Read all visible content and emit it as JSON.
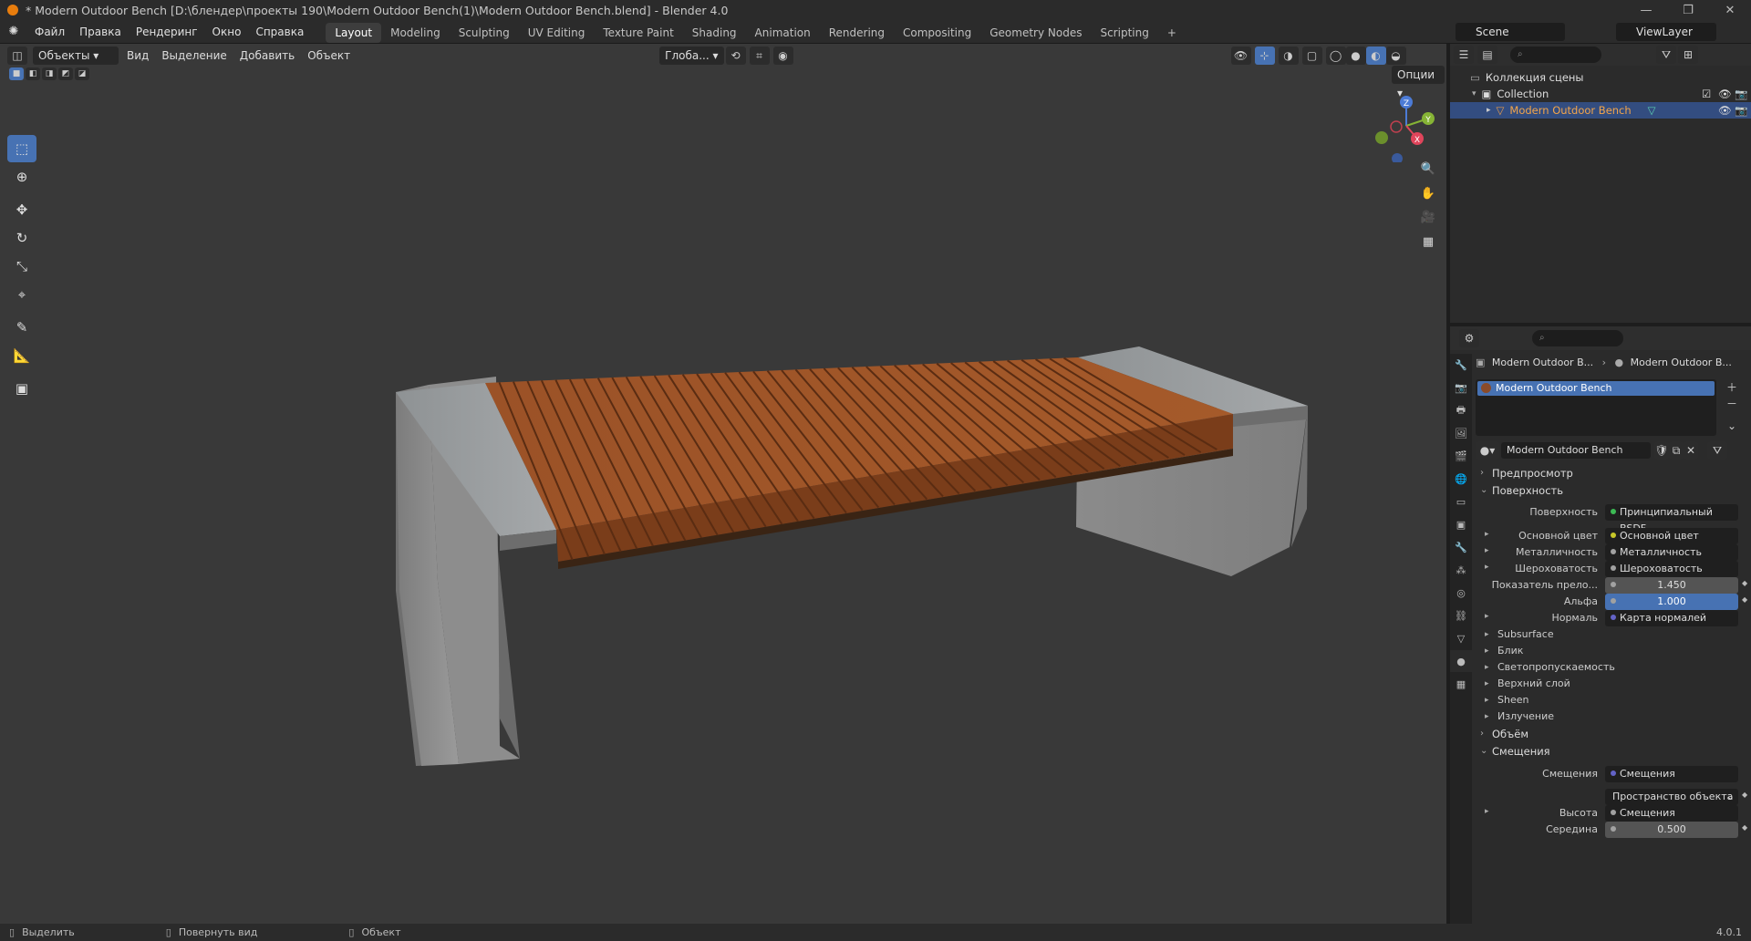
{
  "window": {
    "title": "* Modern Outdoor Bench [D:\\блендер\\проекты 190\\Modern Outdoor Bench(1)\\Modern Outdoor Bench.blend] - Blender 4.0",
    "minimize": "—",
    "maximize": "❐",
    "close": "✕"
  },
  "menu": [
    "Файл",
    "Правка",
    "Рендеринг",
    "Окно",
    "Справка"
  ],
  "workspaces": [
    "Layout",
    "Modeling",
    "Sculpting",
    "UV Editing",
    "Texture Paint",
    "Shading",
    "Animation",
    "Rendering",
    "Compositing",
    "Geometry Nodes",
    "Scripting"
  ],
  "workspace_add": "+",
  "scene": "Scene",
  "view_layer": "ViewLayer",
  "viewport_header": {
    "mode": "Объекты",
    "menus": [
      "Вид",
      "Выделение",
      "Добавить",
      "Объект"
    ],
    "orientation": "Глоба...",
    "options": "Опции"
  },
  "gizmo": {
    "x": "X",
    "y": "Y",
    "z": "Z"
  },
  "outliner": {
    "root": "Коллекция сцены",
    "collection": "Collection",
    "object": "Modern Outdoor Bench"
  },
  "properties": {
    "breadcrumb_object": "Modern Outdoor B...",
    "breadcrumb_material": "Modern Outdoor B...",
    "slot_name": "Modern Outdoor Bench",
    "material_name": "Modern Outdoor Bench",
    "sections": {
      "preview": "Предпросмотр",
      "surface": "Поверхность",
      "volume": "Объём",
      "displacement": "Смещения"
    },
    "surface_rows": [
      {
        "label": "Поверхность",
        "value": "Принципиальный BSDF",
        "dot": "#3cba54",
        "arrow": false,
        "type": "link"
      },
      {
        "label": "Основной цвет",
        "value": "Основной цвет",
        "dot": "#c7c729",
        "arrow": true,
        "type": "link"
      },
      {
        "label": "Металличность",
        "value": "Металличность",
        "dot": "#a1a1a1",
        "arrow": true,
        "type": "link"
      },
      {
        "label": "Шероховатость",
        "value": "Шероховатость",
        "dot": "#a1a1a1",
        "arrow": true,
        "type": "link"
      },
      {
        "label": "Показатель прело...",
        "value": "1.450",
        "dot": "#a1a1a1",
        "arrow": false,
        "type": "num"
      },
      {
        "label": "Альфа",
        "value": "1.000",
        "dot": "#a1a1a1",
        "arrow": false,
        "type": "blue"
      },
      {
        "label": "Нормаль",
        "value": "Карта нормалей",
        "dot": "#6363c7",
        "arrow": true,
        "type": "link"
      }
    ],
    "subpanels": [
      "Subsurface",
      "Блик",
      "Светопропускаемость",
      "Верхний слой",
      "Sheen",
      "Излучение"
    ],
    "displacement_rows": [
      {
        "label": "Смещения",
        "value": "Смещения",
        "dot": "#6363c7",
        "arrow": false,
        "type": "link"
      },
      {
        "label": "",
        "value": "Пространство объекта",
        "dot": "",
        "arrow": false,
        "type": "dropdown"
      },
      {
        "label": "Высота",
        "value": "Смещения",
        "dot": "#a1a1a1",
        "arrow": true,
        "type": "link"
      },
      {
        "label": "Середина",
        "value": "0.500",
        "dot": "#a1a1a1",
        "arrow": false,
        "type": "num"
      }
    ]
  },
  "statusbar": {
    "select": "Выделить",
    "rotate": "Повернуть вид",
    "object": "Объект",
    "version": "4.0.1"
  },
  "colors": {
    "accent": "#4772b3",
    "wood": "#a2582a",
    "concrete": "#8a8a8a",
    "viewport": "#393939"
  }
}
